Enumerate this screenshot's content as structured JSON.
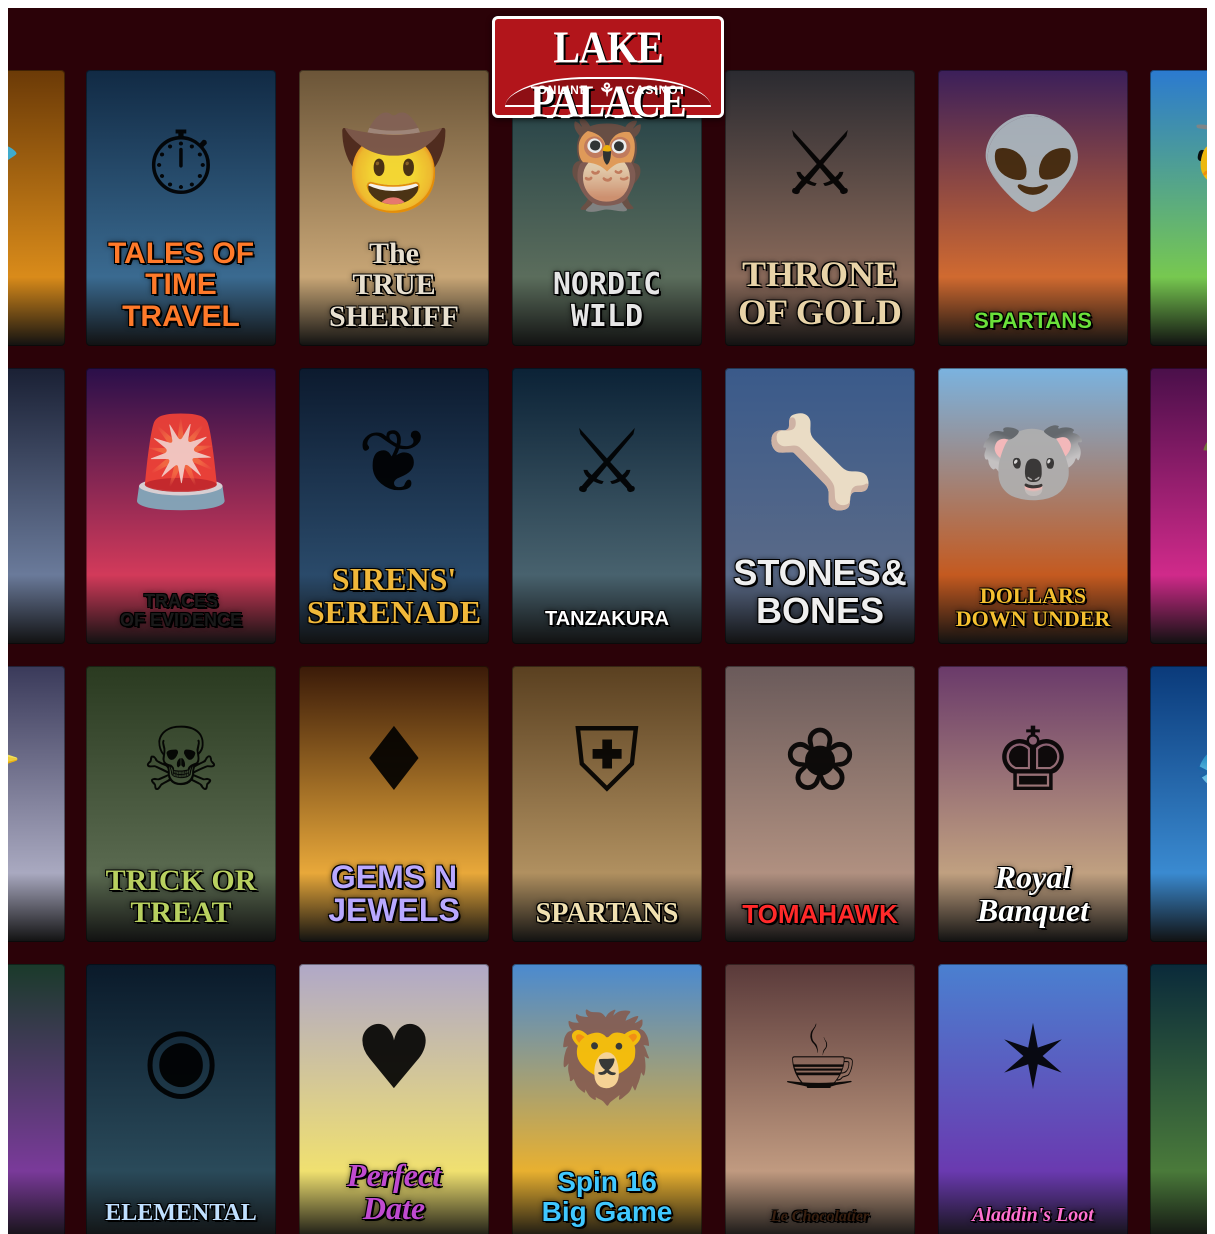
{
  "brand": {
    "name": "LAKE PALACE",
    "left_word": "ONLINE",
    "right_word": "CASINO",
    "icon": "maple-leaf-icon",
    "accent": "#b2151b"
  },
  "background_color": "#2b0208",
  "games": [
    {
      "id": "r0c0",
      "title": "ED",
      "icon": "bird-icon",
      "bg": [
        "#6b3a07",
        "#d98b1a"
      ],
      "color": "#f5c542",
      "font": "t-serif",
      "size": 38
    },
    {
      "id": "r0c1",
      "title": "TALES OF\nTIME\nTRAVEL",
      "icon": "clock-icon",
      "bg": [
        "#112a44",
        "#3a6a90"
      ],
      "color": "#ff7a2a",
      "font": "t-sans",
      "size": 30
    },
    {
      "id": "r0c2",
      "title": "The\nTRUE\nSHERIFF",
      "icon": "cowboy-icon",
      "bg": [
        "#6b5538",
        "#c8a676"
      ],
      "color": "#e8e0d0",
      "font": "t-serif",
      "size": 30
    },
    {
      "id": "r0c3",
      "title": "NORDIC\nWILD",
      "icon": "owl-icon",
      "bg": [
        "#1d3b44",
        "#5b6d5c"
      ],
      "color": "#e6e6e6",
      "font": "t-mono",
      "size": 30
    },
    {
      "id": "r0c4",
      "title": "THRONE\nOF GOLD",
      "icon": "knight-icon",
      "bg": [
        "#2a2a30",
        "#8a6a5a"
      ],
      "color": "#e8d3a8",
      "font": "t-serif",
      "size": 36
    },
    {
      "id": "r0c5",
      "title": "SPARTANS",
      "icon": "alien-icon",
      "bg": [
        "#3b1f5a",
        "#d06a30"
      ],
      "color": "#6be03a",
      "font": "t-sans",
      "size": 22
    },
    {
      "id": "r0c6",
      "title": "Sh\nB",
      "icon": "bee-icon",
      "bg": [
        "#2b7ad0",
        "#77c850"
      ],
      "color": "#ffd23a",
      "font": "t-sans",
      "size": 30
    },
    {
      "id": "r1c0",
      "title": "d\nld",
      "icon": "moon-icon",
      "bg": [
        "#1a2034",
        "#6a7a9a"
      ],
      "color": "#ffffff",
      "font": "t-serif",
      "size": 34
    },
    {
      "id": "r1c1",
      "title": "TRACES\nOF EVIDENCE",
      "icon": "police-light-icon",
      "bg": [
        "#2a0f4a",
        "#d23a5a"
      ],
      "color": "#1a1a1a",
      "font": "t-sans",
      "size": 18
    },
    {
      "id": "r1c2",
      "title": "SIRENS'\nSERENADE",
      "icon": "siren-icon",
      "bg": [
        "#0c1a2e",
        "#2a4a6a"
      ],
      "color": "#f0b83a",
      "font": "t-serif",
      "size": 32
    },
    {
      "id": "r1c3",
      "title": "TANZAKURA",
      "icon": "samurai-icon",
      "bg": [
        "#0b2236",
        "#48626e"
      ],
      "color": "#ffffff",
      "font": "t-sans",
      "size": 20
    },
    {
      "id": "r1c4",
      "title": "STONES&\nBONES",
      "icon": "caveman-icon",
      "bg": [
        "#3a5a8a",
        "#5a6a88"
      ],
      "color": "#efefef",
      "font": "t-sans",
      "size": 36
    },
    {
      "id": "r1c5",
      "title": "DOLLARS\nDOWN UNDER",
      "icon": "koala-icon",
      "bg": [
        "#7ab3e0",
        "#c45a20"
      ],
      "color": "#f5c030",
      "font": "t-serif",
      "size": 22
    },
    {
      "id": "r1c6",
      "title": "Cas",
      "icon": "palm-icon",
      "bg": [
        "#4a0f4a",
        "#d02a8a"
      ],
      "color": "#ff6ab0",
      "font": "t-sans",
      "size": 22
    },
    {
      "id": "r2c0",
      "title": "O\nos",
      "icon": "wizard-icon",
      "bg": [
        "#3a3a5a",
        "#a9a9c0"
      ],
      "color": "#f0d060",
      "font": "t-serif",
      "size": 30
    },
    {
      "id": "r2c1",
      "title": "TRICK OR\nTREAT",
      "icon": "zombie-icon",
      "bg": [
        "#2a3a20",
        "#5a6a50"
      ],
      "color": "#b8d060",
      "font": "t-serif",
      "size": 30
    },
    {
      "id": "r2c2",
      "title": "GEMS N\nJEWELS",
      "icon": "gem-icon",
      "bg": [
        "#3a1a08",
        "#e8a83a"
      ],
      "color": "#b8a8ff",
      "font": "t-sans",
      "size": 32
    },
    {
      "id": "r2c3",
      "title": "SPARTANS",
      "icon": "spartan-icon",
      "bg": [
        "#5a4020",
        "#b09060"
      ],
      "color": "#f0e0b0",
      "font": "t-serif",
      "size": 28
    },
    {
      "id": "r2c4",
      "title": "TOMAHAWK",
      "icon": "chief-icon",
      "bg": [
        "#6a5a5a",
        "#b09080"
      ],
      "color": "#ff2a2a",
      "font": "t-sans",
      "size": 26
    },
    {
      "id": "r2c5",
      "title": "Royal\nBanquet",
      "icon": "king-icon",
      "bg": [
        "#6a3a6a",
        "#c0a080"
      ],
      "color": "#ffffff",
      "font": "t-serif t-italic",
      "size": 32
    },
    {
      "id": "r2c6",
      "title": "E\nEn",
      "icon": "fish-icon",
      "bg": [
        "#0a3a7a",
        "#3a8ad0"
      ],
      "color": "#ffffff",
      "font": "t-serif",
      "size": 30
    },
    {
      "id": "r3c0",
      "title": "nds",
      "icon": "rainbow-icon",
      "bg": [
        "#1a3a2a",
        "#7a3a9a"
      ],
      "color": "#ffffff",
      "font": "t-serif",
      "size": 30
    },
    {
      "id": "r3c1",
      "title": "ELEMENTAL",
      "icon": "orb-icon",
      "bg": [
        "#0a1a2a",
        "#2a4a5a"
      ],
      "color": "#c0e0ff",
      "font": "t-serif",
      "size": 24
    },
    {
      "id": "r3c2",
      "title": "Perfect\nDate",
      "icon": "couple-icon",
      "bg": [
        "#b0a8c8",
        "#f0e070"
      ],
      "color": "#c04ad0",
      "font": "t-serif t-italic",
      "size": 32
    },
    {
      "id": "r3c3",
      "title": "Spin 16\nBig Game",
      "icon": "lion-icon",
      "bg": [
        "#4a8ad0",
        "#e8b030"
      ],
      "color": "#40c8ff",
      "font": "t-sans",
      "size": 28
    },
    {
      "id": "r3c4",
      "title": "Le Chocolatier",
      "icon": "chef-icon",
      "bg": [
        "#5a3a3a",
        "#c09a80"
      ],
      "color": "#3a2010",
      "font": "t-serif t-italic",
      "size": 16
    },
    {
      "id": "r3c5",
      "title": "Aladdin's Loot",
      "icon": "genie-icon",
      "bg": [
        "#4a80d0",
        "#6a3ab0"
      ],
      "color": "#ff70d0",
      "font": "t-serif t-italic",
      "size": 20
    },
    {
      "id": "r3c6",
      "title": "Ele",
      "icon": "orb-icon",
      "bg": [
        "#0a2a3a",
        "#4a7a3a"
      ],
      "color": "#c0e0ff",
      "font": "t-serif",
      "size": 26
    }
  ]
}
